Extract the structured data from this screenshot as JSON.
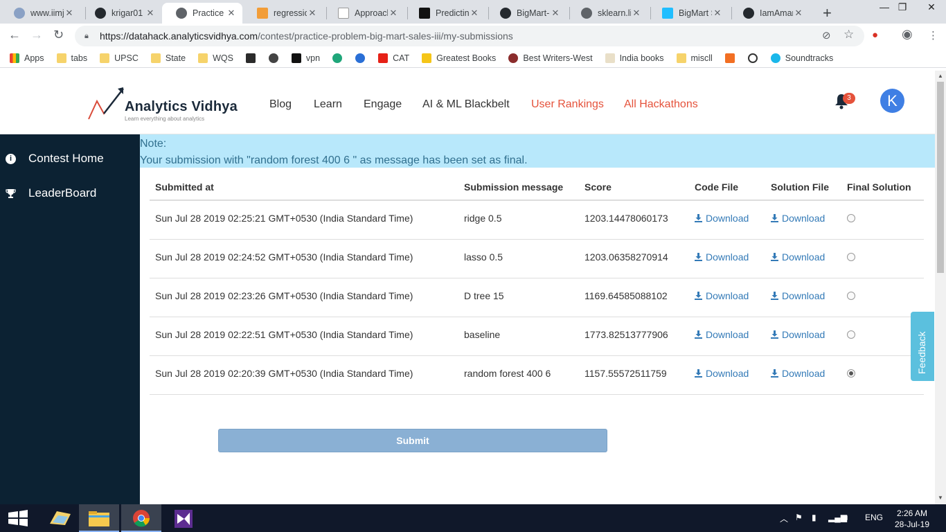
{
  "browser": {
    "tabs": [
      {
        "label": "www.iimjobs",
        "active": false
      },
      {
        "label": "krigar01",
        "active": false
      },
      {
        "label": "Practice Problem",
        "active": true
      },
      {
        "label": "regression",
        "active": false
      },
      {
        "label": "Approach",
        "active": false
      },
      {
        "label": "Predicting",
        "active": false
      },
      {
        "label": "BigMart-Sales",
        "active": false
      },
      {
        "label": "sklearn.linear",
        "active": false
      },
      {
        "label": "BigMart Sales",
        "active": false
      },
      {
        "label": "IamAman",
        "active": false
      }
    ],
    "url_host": "https://datahack.analyticsvidhya.com",
    "url_path": "/contest/practice-problem-big-mart-sales-iii/my-submissions",
    "bookmarks": [
      "Apps",
      "tabs",
      "UPSC",
      "State",
      "WQS",
      "",
      "",
      "vpn",
      "",
      "",
      "CAT",
      "Greatest Books",
      "Best Writers-West",
      "India books",
      "miscll",
      "",
      "",
      "Soundtracks"
    ]
  },
  "header": {
    "logo_title": "Analytics Vidhya",
    "logo_subtitle": "Learn everything about analytics",
    "nav": [
      {
        "label": "Blog",
        "highlight": false
      },
      {
        "label": "Learn",
        "highlight": false
      },
      {
        "label": "Engage",
        "highlight": false
      },
      {
        "label": "AI & ML Blackbelt",
        "highlight": false
      },
      {
        "label": "User Rankings",
        "highlight": true
      },
      {
        "label": "All Hackathons",
        "highlight": true
      }
    ],
    "notification_count": "3",
    "avatar_letter": "K"
  },
  "sidebar": {
    "items": [
      {
        "label": "Contest Home",
        "icon": "info-icon"
      },
      {
        "label": "LeaderBoard",
        "icon": "trophy-icon"
      }
    ]
  },
  "note": {
    "title": "Note:",
    "message": "Your submission with \"random forest 400 6 \" as message has been set as final."
  },
  "table": {
    "headers": [
      "Submitted at",
      "Submission message",
      "Score",
      "Code File",
      "Solution File",
      "Final Solution"
    ],
    "rows": [
      {
        "submitted_at": "Sun Jul 28 2019 02:25:21 GMT+0530 (India Standard Time)",
        "message": "ridge 0.5",
        "score": "1203.14478060173",
        "code": "Download",
        "solution": "Download",
        "final": false
      },
      {
        "submitted_at": "Sun Jul 28 2019 02:24:52 GMT+0530 (India Standard Time)",
        "message": "lasso 0.5",
        "score": "1203.06358270914",
        "code": "Download",
        "solution": "Download",
        "final": false
      },
      {
        "submitted_at": "Sun Jul 28 2019 02:23:26 GMT+0530 (India Standard Time)",
        "message": "D tree 15",
        "score": "1169.64585088102",
        "code": "Download",
        "solution": "Download",
        "final": false
      },
      {
        "submitted_at": "Sun Jul 28 2019 02:22:51 GMT+0530 (India Standard Time)",
        "message": "baseline",
        "score": "1773.82513777906",
        "code": "Download",
        "solution": "Download",
        "final": false
      },
      {
        "submitted_at": "Sun Jul 28 2019 02:20:39 GMT+0530 (India Standard Time)",
        "message": "random forest 400 6",
        "score": "1157.55572511759",
        "code": "Download",
        "solution": "Download",
        "final": true
      }
    ]
  },
  "submit_label": "Submit",
  "feedback_label": "Feedback",
  "taskbar": {
    "language": "ENG",
    "time": "2:26 AM",
    "date": "28-Jul-19"
  },
  "colors": {
    "sidebar_bg": "#0c2233",
    "note_bg": "#b8e8fb",
    "link": "#337ab7",
    "accent_red": "#e5523b",
    "submit_bg": "#8ab0d4"
  }
}
